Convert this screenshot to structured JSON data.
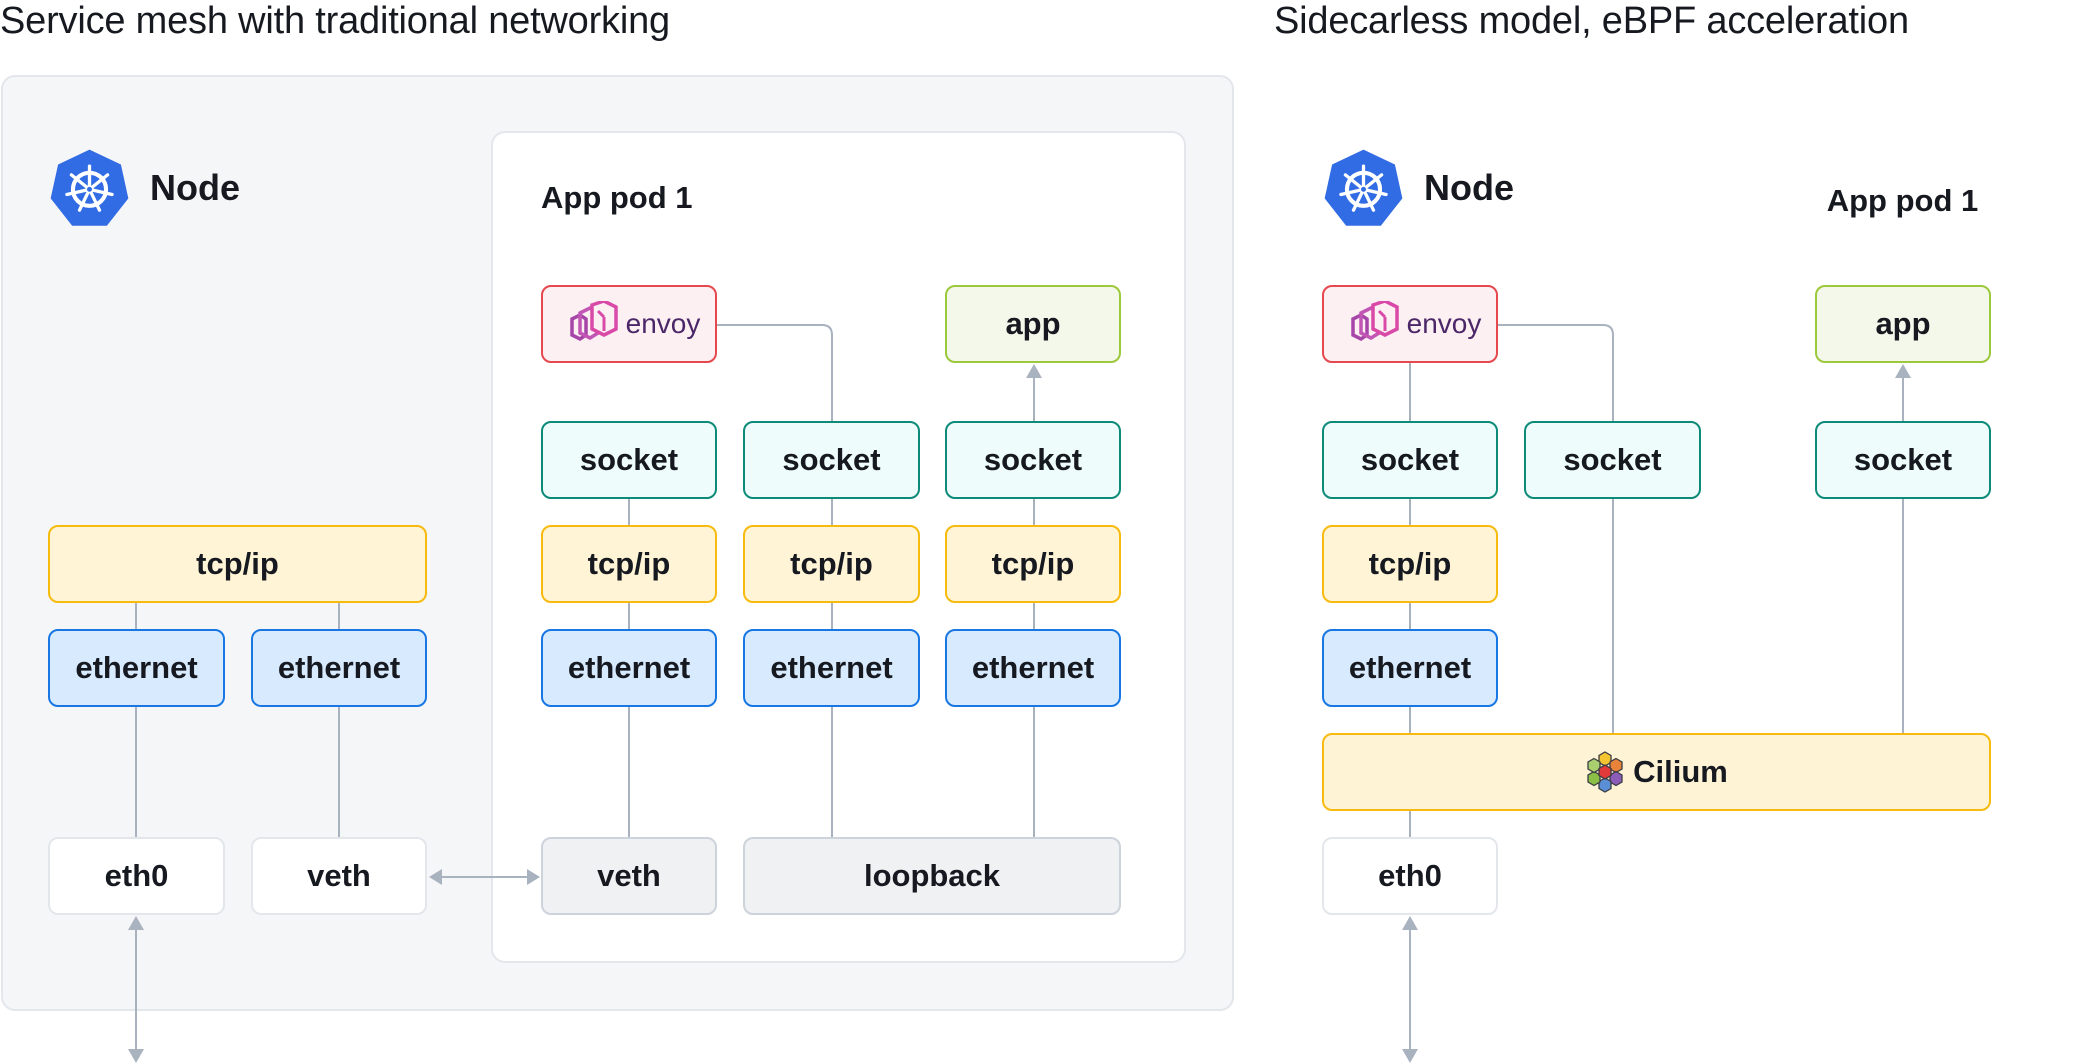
{
  "panels": {
    "left": {
      "title": "Service mesh with traditional networking",
      "node_label": "Node",
      "node_icon": "kubernetes-icon",
      "pod_label": "App pod 1",
      "host_stack": {
        "tcpip": "tcp/ip",
        "ethernet": [
          "ethernet",
          "ethernet"
        ],
        "interfaces": [
          "eth0",
          "veth"
        ]
      },
      "pod": {
        "envoy": "envoy",
        "app": "app",
        "sockets": [
          "socket",
          "socket",
          "socket"
        ],
        "tcpips": [
          "tcp/ip",
          "tcp/ip",
          "tcp/ip"
        ],
        "ethernets": [
          "ethernet",
          "ethernet",
          "ethernet"
        ],
        "veth": "veth",
        "loopback": "loopback"
      }
    },
    "right": {
      "title": "Sidecarless model, eBPF acceleration",
      "node_label": "Node",
      "node_icon": "kubernetes-icon",
      "pod_label": "App pod 1",
      "node_stack": {
        "envoy": "envoy",
        "sockets": [
          "socket",
          "socket"
        ],
        "tcpip": "tcp/ip",
        "ethernet": "ethernet",
        "cilium": "Cilium",
        "eth0": "eth0"
      },
      "pod": {
        "app": "app",
        "socket": "socket"
      }
    }
  },
  "colors": {
    "kubernetes_blue": "#326ce5",
    "socket_border": "#0e8a79",
    "tcpip_border": "#f7bb10",
    "ethernet_border": "#1877e3",
    "envoy_border": "#e5484d",
    "app_border": "#9cc93c",
    "connector": "#a9b2bf"
  }
}
